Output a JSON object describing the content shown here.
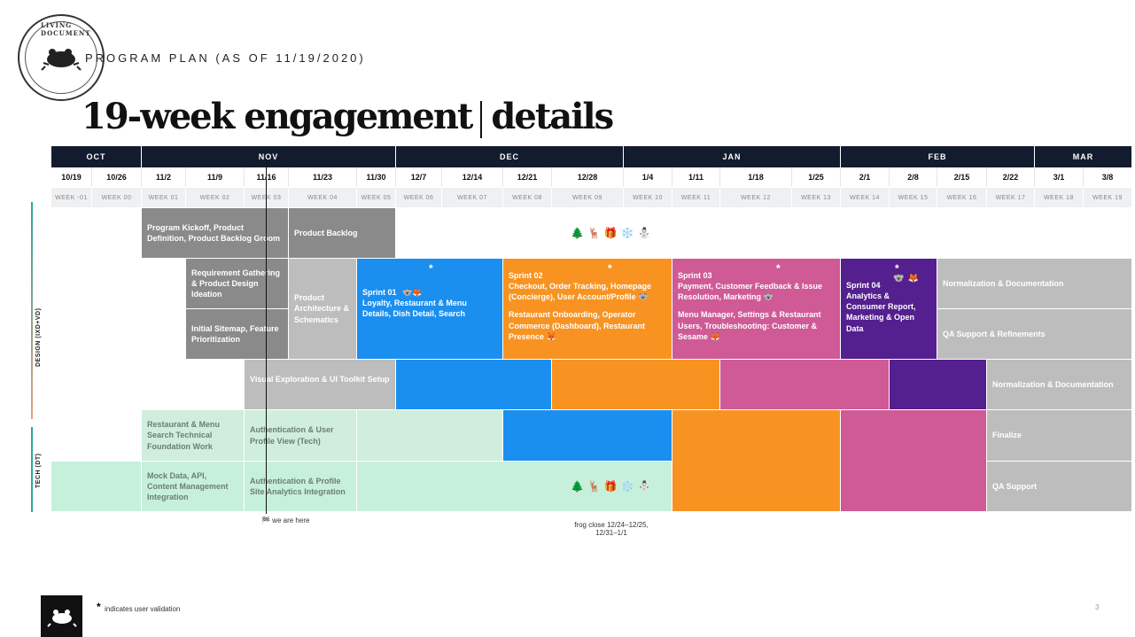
{
  "header": {
    "stamp_text": "LIVING DOCUMENT",
    "subtitle": "PROGRAM PLAN (AS OF 11/19/2020)",
    "title_main": "19-week engagement",
    "title_detail": "details"
  },
  "months": [
    "OCT",
    "NOV",
    "DEC",
    "JAN",
    "FEB",
    "MAR"
  ],
  "dates": [
    "10/19",
    "10/26",
    "11/2",
    "11/9",
    "11/16",
    "11/23",
    "11/30",
    "12/7",
    "12/14",
    "12/21",
    "12/28",
    "1/4",
    "1/11",
    "1/18",
    "1/25",
    "2/1",
    "2/8",
    "2/15",
    "2/22",
    "3/1",
    "3/8"
  ],
  "weeks": [
    "WEEK -01",
    "WEEK 00",
    "WEEK 01",
    "WEEK 02",
    "WEEK 03",
    "WEEK 04",
    "WEEK 05",
    "WEEK 06",
    "WEEK 07",
    "WEEK 08",
    "WEEK 09",
    "WEEK 10",
    "WEEK 11",
    "WEEK 12",
    "WEEK 13",
    "WEEK 14",
    "WEEK 15",
    "WEEK 16",
    "WEEK 17",
    "WEEK 18",
    "WEEK 19"
  ],
  "tracks": {
    "design": "DESIGN (IXD+VD)",
    "tech": "TECH (DT)"
  },
  "blocks": {
    "kickoff": "Program Kickoff, Product Definition, Product Backlog Groom",
    "backlog": "Product Backlog",
    "requirements": "Requirement Gathering & Product Design Ideation",
    "sitemap": "Initial Sitemap, Feature Prioritization",
    "architecture": "Product Architecture & Schematics",
    "sprint1_title": "Sprint 01",
    "sprint1_body": "Loyalty, Restaurant & Menu Details, Dish Detail, Search",
    "sprint2_title": "Sprint 02",
    "sprint2_body1": "Checkout, Order Tracking, Homepage (Concierge), User Account/Profile",
    "sprint2_body2": "Restaurant Onboarding, Operator Commerce (Dashboard), Restaurant Presence",
    "sprint3_title": "Sprint 03",
    "sprint3_body1": "Payment, Customer Feedback & Issue Resolution, Marketing",
    "sprint3_body2": "Menu Manager, Settings & Restaurant Users, Troubleshooting: Customer & Sesame",
    "sprint4_title": "Sprint 04",
    "sprint4_body": "Analytics & Consumer Report, Marketing & Open Data",
    "norm_doc_1": "Normalization & Documentation",
    "qa_refine": "QA Support & Refinements",
    "visual": "Visual Exploration & UI Toolkit Setup",
    "norm_doc_2": "Normalization & Documentation",
    "tech_foundation": "Restaurant & Menu Search Technical Foundation Work",
    "auth_user": "Authentication & User Profile View (Tech)",
    "finalize": "Finalize",
    "mock_data": "Mock Data, API, Content Management Integration",
    "auth_profile": "Authentication & Profile Site Analytics Integration",
    "qa_support": "QA Support"
  },
  "holiday_emojis": "🌲🦌🎁❄️⛄",
  "sprint1_emojis": "🐨🦊",
  "sprint2_emoji_a": "🐨",
  "sprint2_emoji_b": "🦊",
  "sprint3_emoji_a": "🐨",
  "sprint3_emoji_b": "🦊",
  "sprint4_emojis": "🐨🦊",
  "star": "*",
  "we_are_here": "🏁 we are here",
  "frog_close": "frog close 12/24–12/25, 12/31–1/1",
  "footnote_star": "*",
  "footnote": "indicates user validation",
  "page_number": "3"
}
